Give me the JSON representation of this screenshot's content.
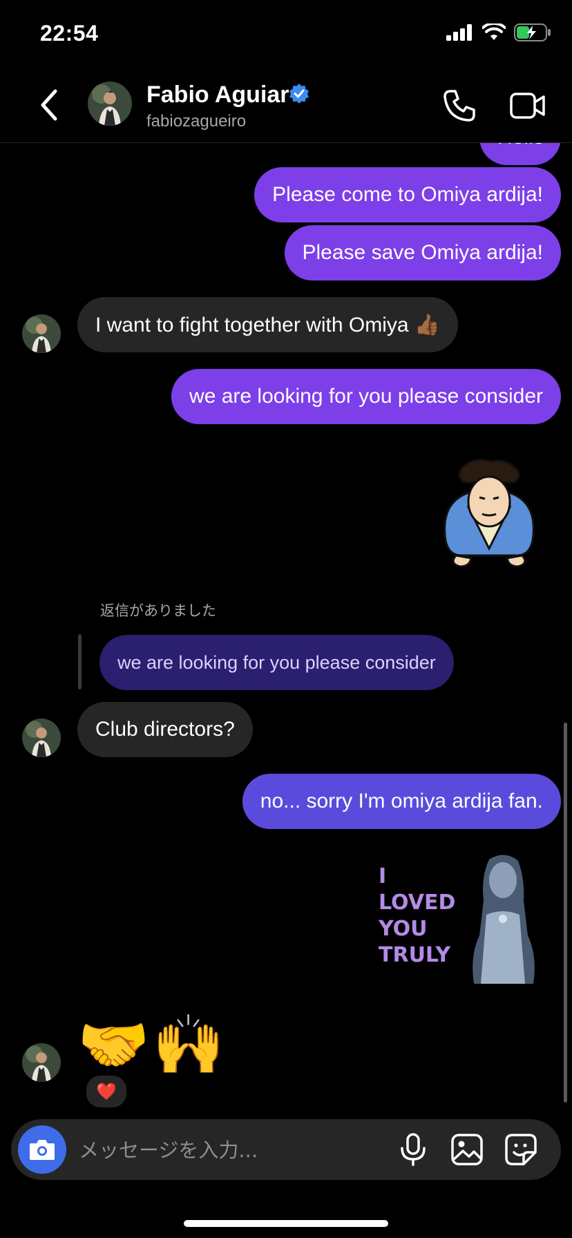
{
  "status_bar": {
    "time": "22:54",
    "battery_color": "#34c759"
  },
  "header": {
    "name": "Fabio Aguiar",
    "handle": "fabiozagueiro",
    "verified": true
  },
  "messages": {
    "partial_top": "Hello",
    "m1": "Please come to Omiya ardija!",
    "m2": "Please save Omiya ardija!",
    "m3": "I want to fight together with Omiya 👍🏾",
    "m4": "we are looking for you please consider",
    "reply_label": "返信がありました",
    "reply_quote": "we are looking for you please consider",
    "m5": "Club directors?",
    "m6": "no... sorry I'm omiya ardija fan.",
    "gif_text": "I\nLOVED\nYOU\nTRULY",
    "emoji_message": "🤝🙌",
    "reaction": "❤️"
  },
  "composer": {
    "placeholder": "メッセージを入力..."
  },
  "colors": {
    "sent": "#7d3fe8",
    "sent_blue": "#5b4bdc",
    "received": "#262626",
    "camera": "#3f6ce8"
  }
}
